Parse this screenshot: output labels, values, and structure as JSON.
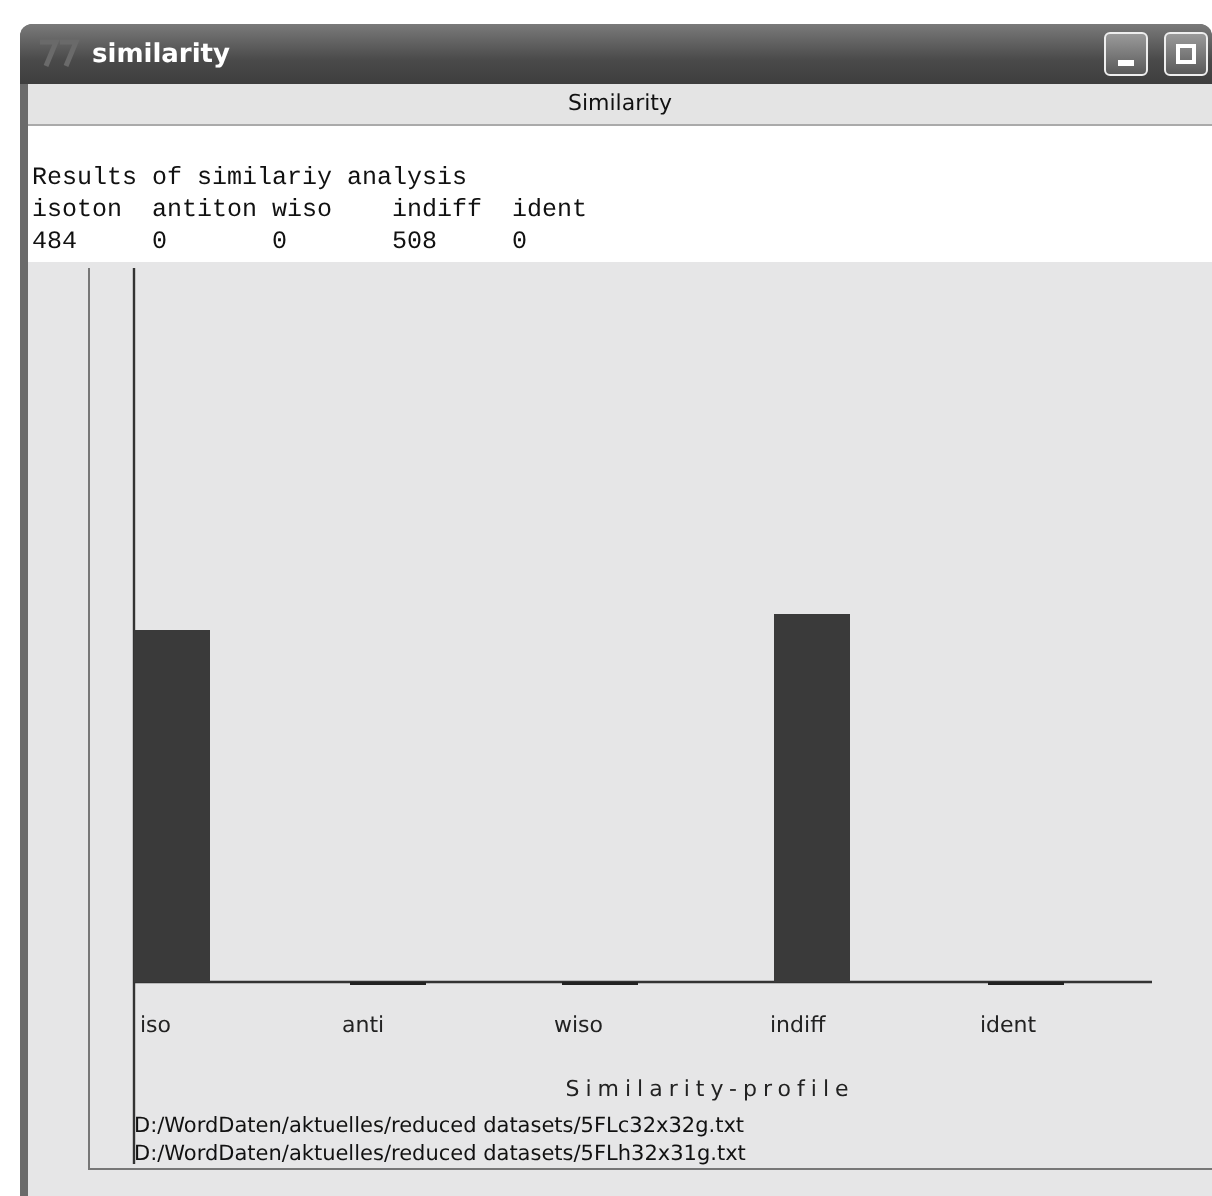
{
  "window": {
    "title": "similarity"
  },
  "header": {
    "title": "Similarity"
  },
  "results": {
    "lines": [
      "Results of similariy analysis",
      "isoton  antiton wiso    indiff  ident",
      "484     0       0       508     0"
    ]
  },
  "chart": {
    "categories": [
      "iso",
      "anti",
      "wiso",
      "indiff",
      "ident"
    ],
    "xlabel": "Similarity-profile"
  },
  "files": [
    "D:/WordDaten/aktuelles/reduced datasets/5FLc32x32g.txt",
    "D:/WordDaten/aktuelles/reduced datasets/5FLh32x31g.txt"
  ]
}
